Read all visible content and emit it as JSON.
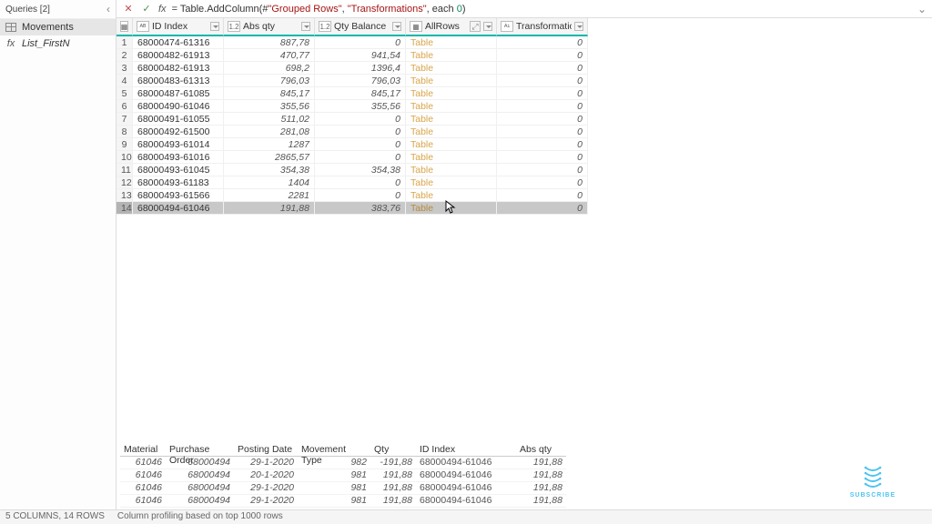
{
  "sidebar": {
    "title": "Queries [2]",
    "items": [
      {
        "label": "Movements",
        "type": "table",
        "selected": true
      },
      {
        "label": "List_FirstN",
        "type": "fx",
        "selected": false
      }
    ]
  },
  "formula_bar": {
    "prefix": "= Table.AddColumn(#",
    "str1": "\"Grouped Rows\"",
    "sep1": ", ",
    "str2": "\"Transformations\"",
    "sep2": ", each ",
    "num": "0",
    "suffix": ")"
  },
  "grid": {
    "columns": [
      {
        "type": "ABC",
        "label": "ID Index"
      },
      {
        "type": "1.2",
        "label": "Abs qty"
      },
      {
        "type": "1.2",
        "label": "Qty Balance"
      },
      {
        "type": "tbl",
        "label": "AllRows"
      },
      {
        "type": "ABC123",
        "label": "Transformations"
      }
    ],
    "rows": [
      {
        "n": 1,
        "id": "68000474-61316",
        "abs": "887,78",
        "bal": "0",
        "all": "Table",
        "tr": "0"
      },
      {
        "n": 2,
        "id": "68000482-61913",
        "abs": "470,77",
        "bal": "941,54",
        "all": "Table",
        "tr": "0"
      },
      {
        "n": 3,
        "id": "68000482-61913",
        "abs": "698,2",
        "bal": "1396,4",
        "all": "Table",
        "tr": "0"
      },
      {
        "n": 4,
        "id": "68000483-61313",
        "abs": "796,03",
        "bal": "796,03",
        "all": "Table",
        "tr": "0"
      },
      {
        "n": 5,
        "id": "68000487-61085",
        "abs": "845,17",
        "bal": "845,17",
        "all": "Table",
        "tr": "0"
      },
      {
        "n": 6,
        "id": "68000490-61046",
        "abs": "355,56",
        "bal": "355,56",
        "all": "Table",
        "tr": "0"
      },
      {
        "n": 7,
        "id": "68000491-61055",
        "abs": "511,02",
        "bal": "0",
        "all": "Table",
        "tr": "0"
      },
      {
        "n": 8,
        "id": "68000492-61500",
        "abs": "281,08",
        "bal": "0",
        "all": "Table",
        "tr": "0"
      },
      {
        "n": 9,
        "id": "68000493-61014",
        "abs": "1287",
        "bal": "0",
        "all": "Table",
        "tr": "0"
      },
      {
        "n": 10,
        "id": "68000493-61016",
        "abs": "2865,57",
        "bal": "0",
        "all": "Table",
        "tr": "0"
      },
      {
        "n": 11,
        "id": "68000493-61045",
        "abs": "354,38",
        "bal": "354,38",
        "all": "Table",
        "tr": "0"
      },
      {
        "n": 12,
        "id": "68000493-61183",
        "abs": "1404",
        "bal": "0",
        "all": "Table",
        "tr": "0"
      },
      {
        "n": 13,
        "id": "68000493-61566",
        "abs": "2281",
        "bal": "0",
        "all": "Table",
        "tr": "0"
      },
      {
        "n": 14,
        "id": "68000494-61046",
        "abs": "191,88",
        "bal": "383,76",
        "all": "Table",
        "tr": "0",
        "selected": true
      }
    ]
  },
  "detail": {
    "columns": [
      "Material",
      "Purchase Order",
      "Posting Date",
      "Movement Type",
      "Qty",
      "ID Index",
      "Abs qty"
    ],
    "rows": [
      {
        "mat": "61046",
        "po": "68000494",
        "date": "29-1-2020",
        "mt": "982",
        "qty": "-191,88",
        "idx": "68000494-61046",
        "abs": "191,88"
      },
      {
        "mat": "61046",
        "po": "68000494",
        "date": "20-1-2020",
        "mt": "981",
        "qty": "191,88",
        "idx": "68000494-61046",
        "abs": "191,88"
      },
      {
        "mat": "61046",
        "po": "68000494",
        "date": "29-1-2020",
        "mt": "981",
        "qty": "191,88",
        "idx": "68000494-61046",
        "abs": "191,88"
      },
      {
        "mat": "61046",
        "po": "68000494",
        "date": "29-1-2020",
        "mt": "981",
        "qty": "191,88",
        "idx": "68000494-61046",
        "abs": "191,88"
      }
    ]
  },
  "status": {
    "cols_rows": "5 COLUMNS, 14 ROWS",
    "profiling": "Column profiling based on top 1000 rows"
  },
  "logo": {
    "text": "SUBSCRIBE"
  }
}
